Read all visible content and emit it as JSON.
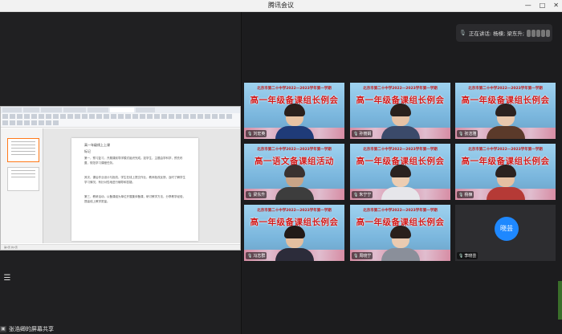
{
  "window": {
    "title": "腾讯会议",
    "controls": [
      "—",
      "□",
      "✕"
    ]
  },
  "speaking": {
    "text": "正在讲话: 杨楝; 梁东升;"
  },
  "share": {
    "label": "张浩卿的屏幕共享"
  },
  "document": {
    "tabs": [
      "",
      "",
      "",
      "",
      "",
      "",
      ""
    ],
    "title": "高一年级线上上课",
    "heading": "标记",
    "paragraphs": [
      "第一，预习复习，开展课前导学模式组织完成。如学生，主题由学科学，预先布置，规范学习课程任务。",
      "其次，课后作业设计与批改，学生在线上提交作业，教师批改反馈，及时了解学生学习情况，有针对性地进行辅导和答疑。",
      "第三，教研活动，以备课组为单位开展集体备课，研讨教学方法，分享教学经验，提高线上教学质量。"
    ],
    "status": "第1页 共1页"
  },
  "tiles": [
    {
      "name": "刘宏英",
      "banner": "高一年级备课组长例会",
      "banner_small": "北京市第二十中学2022—2023学年第一学期",
      "shirt": "#1f3b78",
      "skin": "#e8c3a3",
      "hair": "#2a201c"
    },
    {
      "name": "孙丽娟",
      "banner": "高一年级备课组长例会",
      "banner_small": "北京市第二十中学2022—2023学年第一学期",
      "shirt": "#3b4a6a",
      "skin": "#e6c2a5",
      "hair": "#2a201c"
    },
    {
      "name": "张洁雅",
      "banner": "高一年级备课组长例会",
      "banner_small": "北京市第二十中学2022—2023学年第一学期",
      "shirt": "#5b3a2a",
      "skin": "#e9c8ad",
      "hair": "#2b2220"
    },
    {
      "name": "梁东升",
      "banner": "高一语文备课组活动",
      "banner_small": "北京市第二十中学2022—2023学年第一学期",
      "shirt": "#3d3d3d",
      "skin": "#c9a487",
      "hair": "#3a3230"
    },
    {
      "name": "朱宁宁",
      "banner": "高一年级备课组长例会",
      "banner_small": "北京市第二十中学2022—2023学年第一学期",
      "shirt": "#e6e6ea",
      "skin": "#eccdb2",
      "hair": "#2b2220"
    },
    {
      "name": "杨楝",
      "banner": "高一年级备课组长例会",
      "banner_small": "北京市第二十中学2022—2023学年第一学期",
      "shirt": "#b53a36",
      "skin": "#e5c0a2",
      "hair": "#2b2220"
    },
    {
      "name": "冯志群",
      "banner": "高一年级备课组长例会",
      "banner_small": "北京市第二十中学2022—2023学年第一学期",
      "shirt": "#2c2c3a",
      "skin": "#e4bfa0",
      "hair": "#221a18"
    },
    {
      "name": "周晓宁",
      "banner": "高一年级备课组长例会",
      "banner_small": "北京市第二十中学2022—2023学年第一学期",
      "shirt": "#8a8f9a",
      "skin": "#eacbb1",
      "hair": "#2a201c"
    }
  ],
  "avatar_tile": {
    "initials": "晓芸",
    "name": "李晓芸",
    "circle_color": "#1e88ff"
  },
  "icons": {
    "mic": "mic-icon",
    "menu": "menu-icon",
    "share": "screen-share-icon"
  }
}
